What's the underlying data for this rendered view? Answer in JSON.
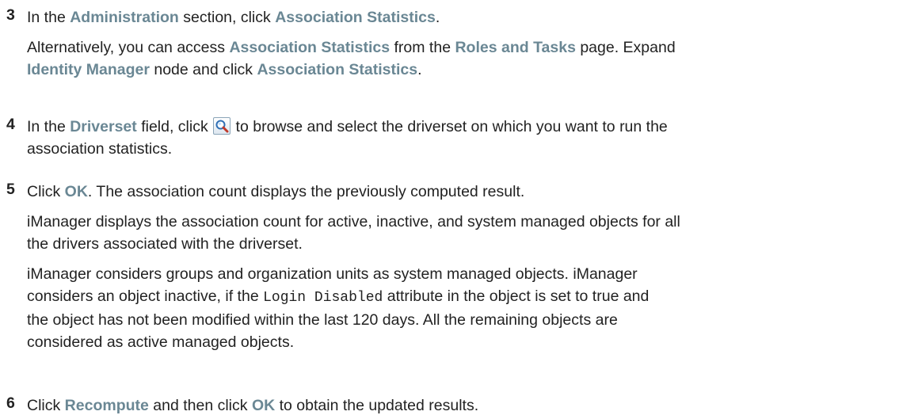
{
  "steps": [
    {
      "number": "3",
      "p1": {
        "t1": "In the ",
        "ui1": "Administration",
        "t2": " section, click ",
        "ui2": "Association Statistics",
        "t3": "."
      },
      "p2": {
        "t1": "Alternatively, you can access ",
        "ui1": "Association Statistics",
        "t2": " from the ",
        "ui2": "Roles and Tasks",
        "t3": " page. Expand",
        "ui3": "Identity Manager",
        "t4": " node and click ",
        "ui4": "Association Statistics",
        "t5": "."
      }
    },
    {
      "number": "4",
      "p1": {
        "t1": "In the ",
        "ui1": "Driverset",
        "t2": " field, click ",
        "icon": "search-icon",
        "t3": " to browse and select the driverset on which you want to run the",
        "t4": "association statistics."
      }
    },
    {
      "number": "5",
      "p1": {
        "t1": "Click ",
        "ui1": "OK",
        "t2": ". The association count displays the previously computed result."
      },
      "p2": {
        "line1": "iManager displays the association count for active, inactive, and system managed objects for all",
        "line2": "the drivers associated with the driverset."
      },
      "p3": {
        "line1": "iManager considers groups and organization units as system managed objects. iManager",
        "t1": "considers an object inactive, if the ",
        "code": "Login Disabled",
        "t2": " attribute in the object is set to true and",
        "line3": "the object has not been modified within the last 120 days. All the remaining objects are",
        "line4": "considered as active managed objects."
      }
    },
    {
      "number": "6",
      "p1": {
        "t1": "Click ",
        "ui1": "Recompute",
        "t2": " and then click ",
        "ui2": "OK",
        "t3": " to obtain the updated results."
      }
    }
  ],
  "colors": {
    "ui_term": "#6a8794",
    "body_text": "#222222"
  }
}
